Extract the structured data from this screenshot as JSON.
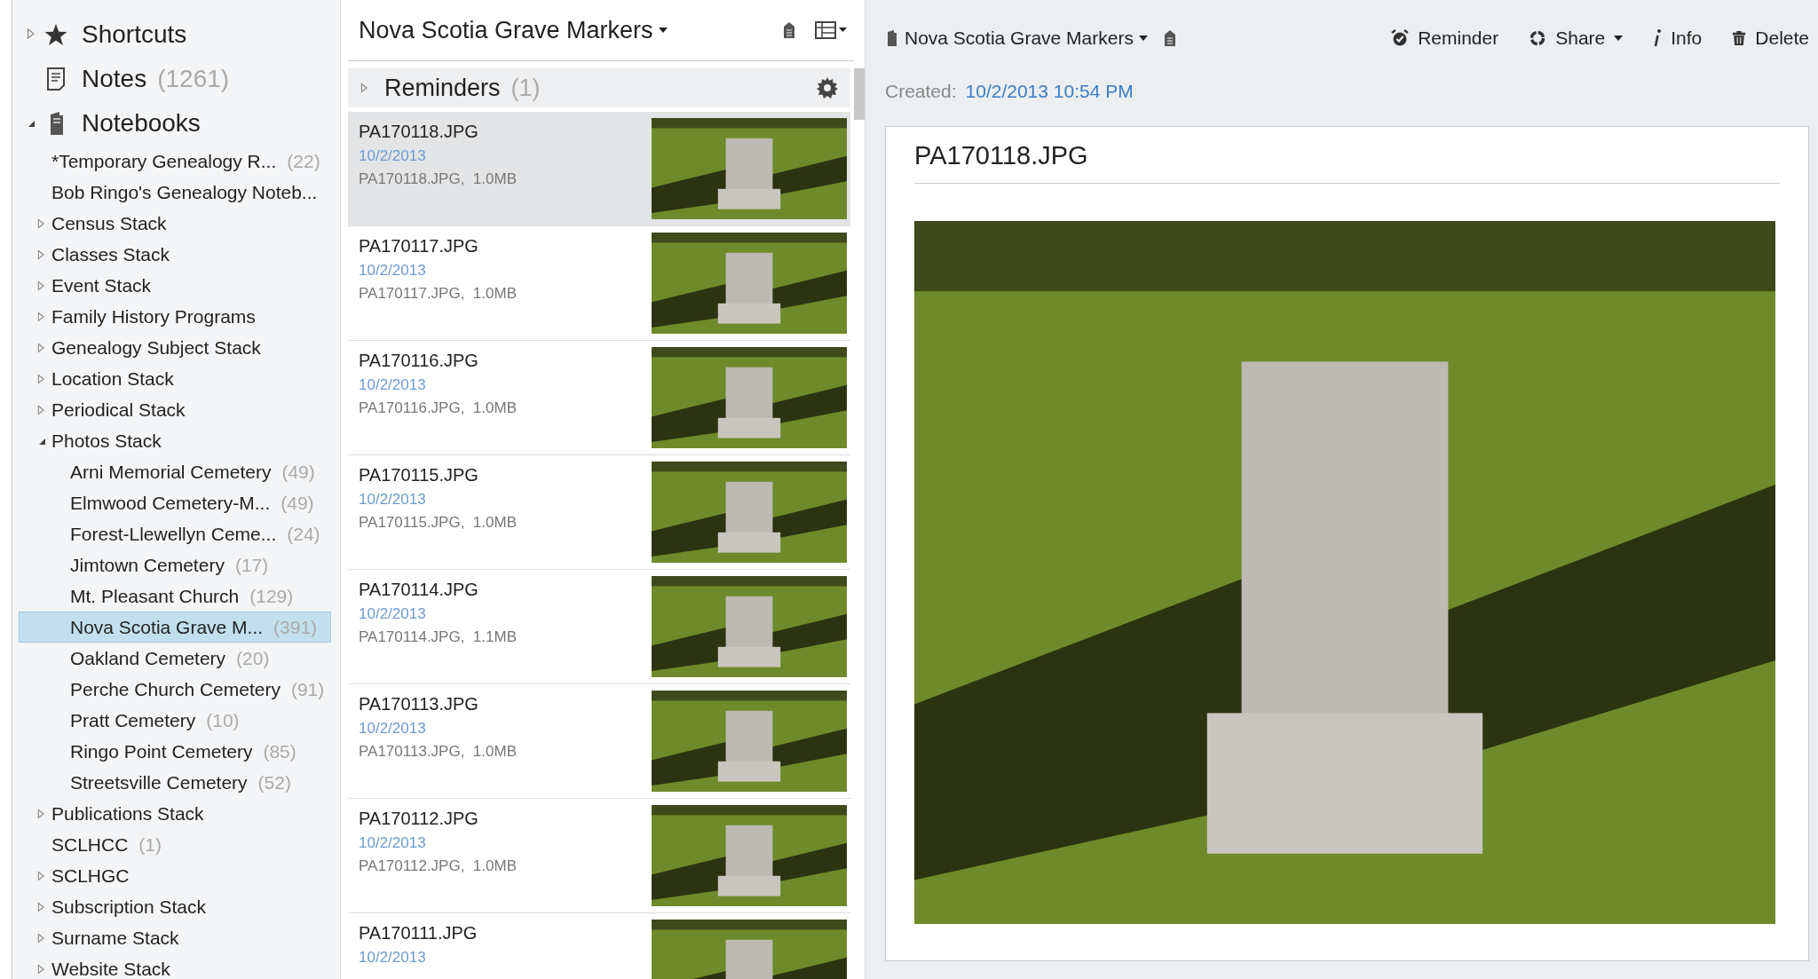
{
  "sidebar": {
    "top_items": [
      {
        "kind": "shortcuts",
        "label": "Shortcuts",
        "expanded": false
      },
      {
        "kind": "notes",
        "label": "Notes",
        "count": "(1261)"
      },
      {
        "kind": "notebooks",
        "label": "Notebooks",
        "expanded": true,
        "children": [
          {
            "label": "*Temporary Genealogy R...",
            "count": "(22)",
            "selected": false
          },
          {
            "label": "Bob Ringo's Genealogy Noteb...",
            "selected": false
          },
          {
            "label": "Census Stack",
            "expanded": false,
            "selected": false
          },
          {
            "label": "Classes Stack",
            "expanded": false,
            "selected": false
          },
          {
            "label": "Event Stack",
            "expanded": false,
            "selected": false
          },
          {
            "label": "Family History Programs",
            "expanded": false,
            "selected": false
          },
          {
            "label": "Genealogy Subject Stack",
            "expanded": false,
            "selected": false
          },
          {
            "label": "Location Stack",
            "expanded": false,
            "selected": false
          },
          {
            "label": "Periodical Stack",
            "expanded": false,
            "selected": false
          },
          {
            "label": "Photos Stack",
            "expanded": true,
            "selected": false,
            "children": [
              {
                "label": "Arni Memorial Cemetery",
                "count": "(49)",
                "selected": false
              },
              {
                "label": "Elmwood Cemetery-M...",
                "count": "(49)",
                "selected": false
              },
              {
                "label": "Forest-Llewellyn Ceme...",
                "count": "(24)",
                "selected": false
              },
              {
                "label": "Jimtown Cemetery",
                "count": "(17)",
                "selected": false
              },
              {
                "label": "Mt. Pleasant Church",
                "count": "(129)",
                "selected": false
              },
              {
                "label": "Nova Scotia Grave M...",
                "count": "(391)",
                "selected": true
              },
              {
                "label": "Oakland Cemetery",
                "count": "(20)",
                "selected": false
              },
              {
                "label": "Perche Church Cemetery",
                "count": "(91)",
                "selected": false
              },
              {
                "label": "Pratt Cemetery",
                "count": "(10)",
                "selected": false
              },
              {
                "label": "Ringo Point Cemetery",
                "count": "(85)",
                "selected": false
              },
              {
                "label": "Streetsville Cemetery",
                "count": "(52)",
                "selected": false
              }
            ]
          },
          {
            "label": "Publications Stack",
            "expanded": false,
            "selected": false
          },
          {
            "label": "SCLHCC",
            "count": "(1)",
            "selected": false
          },
          {
            "label": "SCLHGC",
            "expanded": false,
            "selected": false
          },
          {
            "label": "Subscription Stack",
            "expanded": false,
            "selected": false
          },
          {
            "label": "Surname Stack",
            "expanded": false,
            "selected": false
          },
          {
            "label": "Website Stack",
            "expanded": false,
            "selected": false
          }
        ]
      }
    ]
  },
  "note_list": {
    "title": "Nova Scotia Grave Markers",
    "reminders": {
      "label": "Reminders",
      "count": "(1)",
      "expanded": false
    },
    "notes": [
      {
        "title": "PA170118.JPG",
        "date": "10/2/2013",
        "meta": "PA170118.JPG,  1.0MB",
        "selected": true
      },
      {
        "title": "PA170117.JPG",
        "date": "10/2/2013",
        "meta": "PA170117.JPG,  1.0MB",
        "selected": false
      },
      {
        "title": "PA170116.JPG",
        "date": "10/2/2013",
        "meta": "PA170116.JPG,  1.0MB",
        "selected": false
      },
      {
        "title": "PA170115.JPG",
        "date": "10/2/2013",
        "meta": "PA170115.JPG,  1.0MB",
        "selected": false
      },
      {
        "title": "PA170114.JPG",
        "date": "10/2/2013",
        "meta": "PA170114.JPG,  1.1MB",
        "selected": false
      },
      {
        "title": "PA170113.JPG",
        "date": "10/2/2013",
        "meta": "PA170113.JPG,  1.0MB",
        "selected": false
      },
      {
        "title": "PA170112.JPG",
        "date": "10/2/2013",
        "meta": "PA170112.JPG,  1.0MB",
        "selected": false
      },
      {
        "title": "PA170111.JPG",
        "date": "10/2/2013",
        "selected": false
      }
    ]
  },
  "note": {
    "notebook": "Nova Scotia Grave Markers",
    "actions": [
      {
        "kind": "reminder",
        "label": "Reminder"
      },
      {
        "kind": "share",
        "label": "Share"
      },
      {
        "kind": "info",
        "label": "Info"
      },
      {
        "kind": "delete",
        "label": "Delete"
      }
    ],
    "created_label": "Created:",
    "created": "10/2/2013 10:54 PM",
    "title": "PA170118.JPG"
  }
}
